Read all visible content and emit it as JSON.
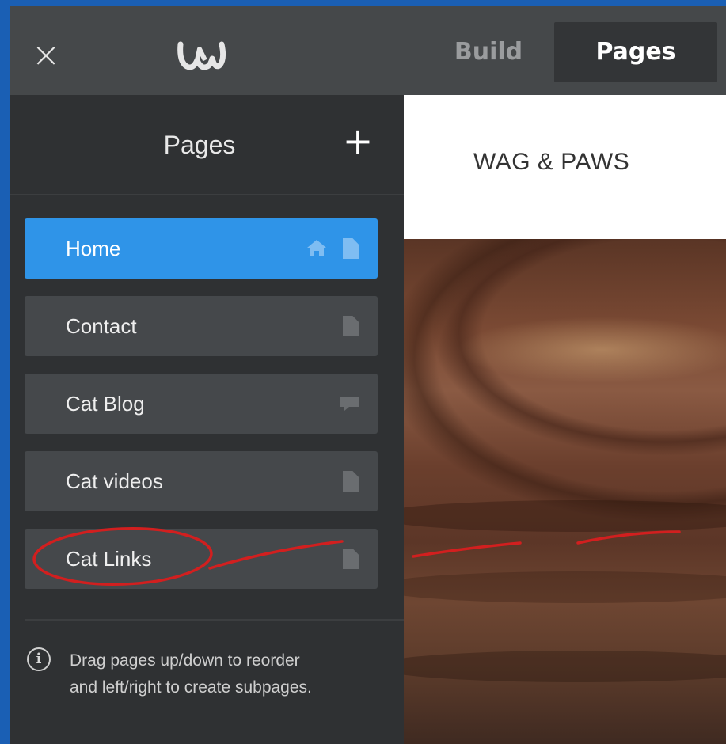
{
  "topbar": {
    "close_icon": "close-icon",
    "logo_icon": "weebly-w-logo",
    "tabs": [
      {
        "label": "Build",
        "active": false
      },
      {
        "label": "Pages",
        "active": true
      }
    ]
  },
  "sidebar": {
    "title": "Pages",
    "add_icon": "plus-icon",
    "pages": [
      {
        "label": "Home",
        "icons": [
          "home-icon",
          "page-icon"
        ],
        "active": true
      },
      {
        "label": "Contact",
        "icons": [
          "page-icon"
        ],
        "active": false
      },
      {
        "label": "Cat Blog",
        "icons": [
          "blog-icon"
        ],
        "active": false
      },
      {
        "label": "Cat videos",
        "icons": [
          "page-icon"
        ],
        "active": false
      },
      {
        "label": "Cat Links",
        "icons": [
          "page-icon"
        ],
        "active": false
      }
    ],
    "hint_icon": "info-icon",
    "hint_line1": "Drag pages up/down to reorder",
    "hint_line2": "and left/right to create subpages."
  },
  "preview": {
    "site_title": "WAG & PAWS"
  },
  "colors": {
    "accent": "#2f94e8",
    "topbar": "#45484a",
    "sidebar": "#2f3133",
    "annotation": "#d21f1f"
  }
}
